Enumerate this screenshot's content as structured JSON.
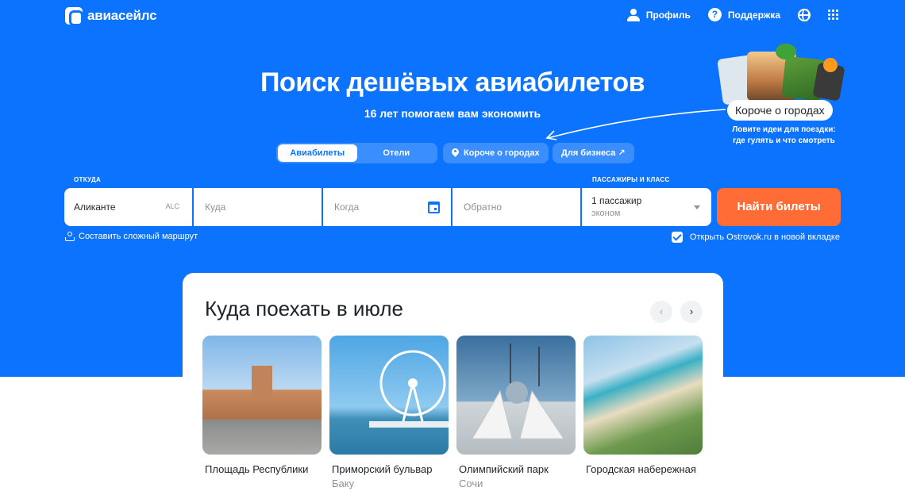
{
  "header": {
    "logo": "авиасейлс",
    "nav": {
      "profile": "Профиль",
      "support": "Поддержка"
    }
  },
  "hero": {
    "title": "Поиск дешёвых авиабилетов",
    "subtitle": "16 лет помогаем вам экономить"
  },
  "tabs": [
    {
      "label": "Авиабилеты",
      "active": true
    },
    {
      "label": "Отели",
      "active": false
    }
  ],
  "pills": {
    "cities": "Короче о городах",
    "business": "Для бизнеса ↗"
  },
  "promo": {
    "label": "Короче о городах",
    "subtitle_line1": "Ловите идеи для поездки:",
    "subtitle_line2": "где гулять и что смотреть"
  },
  "search": {
    "from_label": "ОТКУДА",
    "from_value": "Аликанте",
    "from_code": "ALC",
    "to_placeholder": "Куда",
    "date_placeholder": "Когда",
    "return_placeholder": "Обратно",
    "pax_label": "ПАССАЖИРЫ И КЛАСС",
    "pax_value": "1 пассажир",
    "pax_class": "эконом",
    "submit": "Найти билеты",
    "complex_route": "Составить сложный маршрут",
    "ostrovok": "Открыть Ostrovok.ru в новой вкладке",
    "ostrovok_checked": true
  },
  "recommendations": {
    "title": "Куда поехать в июле",
    "cards": [
      {
        "name": "Площадь Республики",
        "city": ""
      },
      {
        "name": "Приморский бульвар",
        "city": "Баку"
      },
      {
        "name": "Олимпийский парк",
        "city": "Сочи"
      },
      {
        "name": "Городская набережная",
        "city": ""
      }
    ]
  },
  "colors": {
    "brand": "#0c73fe",
    "accent": "#ff6c36"
  }
}
